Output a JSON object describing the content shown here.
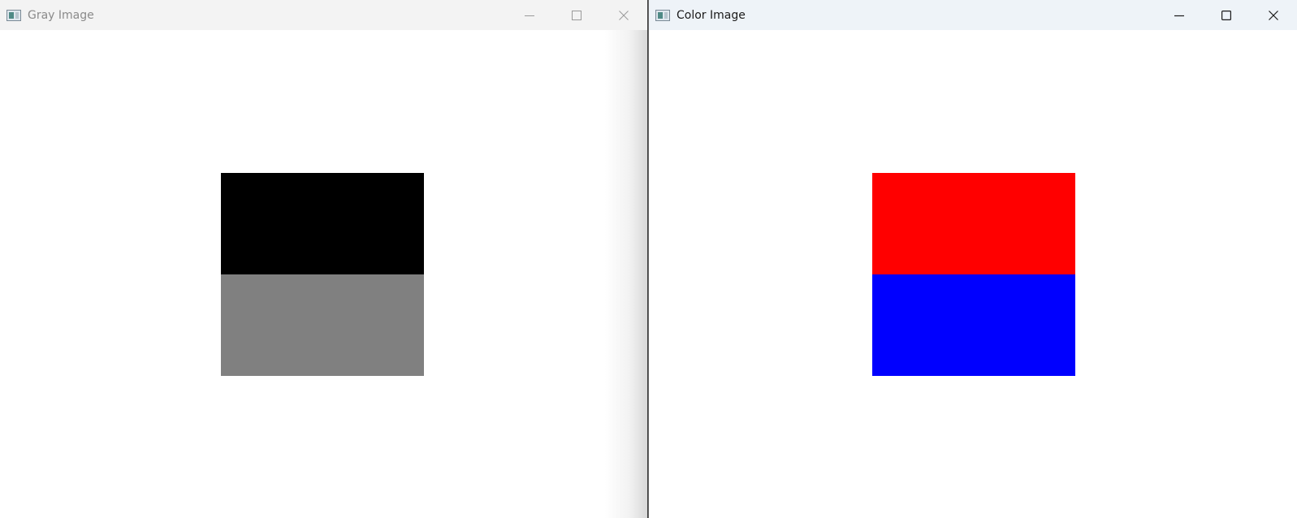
{
  "gray_window": {
    "title": "Gray Image",
    "icon": "window-app-icon",
    "controls": [
      "minimize-icon",
      "maximize-icon",
      "close-icon"
    ],
    "image": {
      "top_color": "#000000",
      "bottom_color": "#808080"
    }
  },
  "color_window": {
    "title": "Color Image",
    "icon": "window-app-icon",
    "controls": [
      "minimize-icon",
      "maximize-icon",
      "close-icon"
    ],
    "image": {
      "top_color": "#ff0000",
      "bottom_color": "#0000ff"
    }
  }
}
